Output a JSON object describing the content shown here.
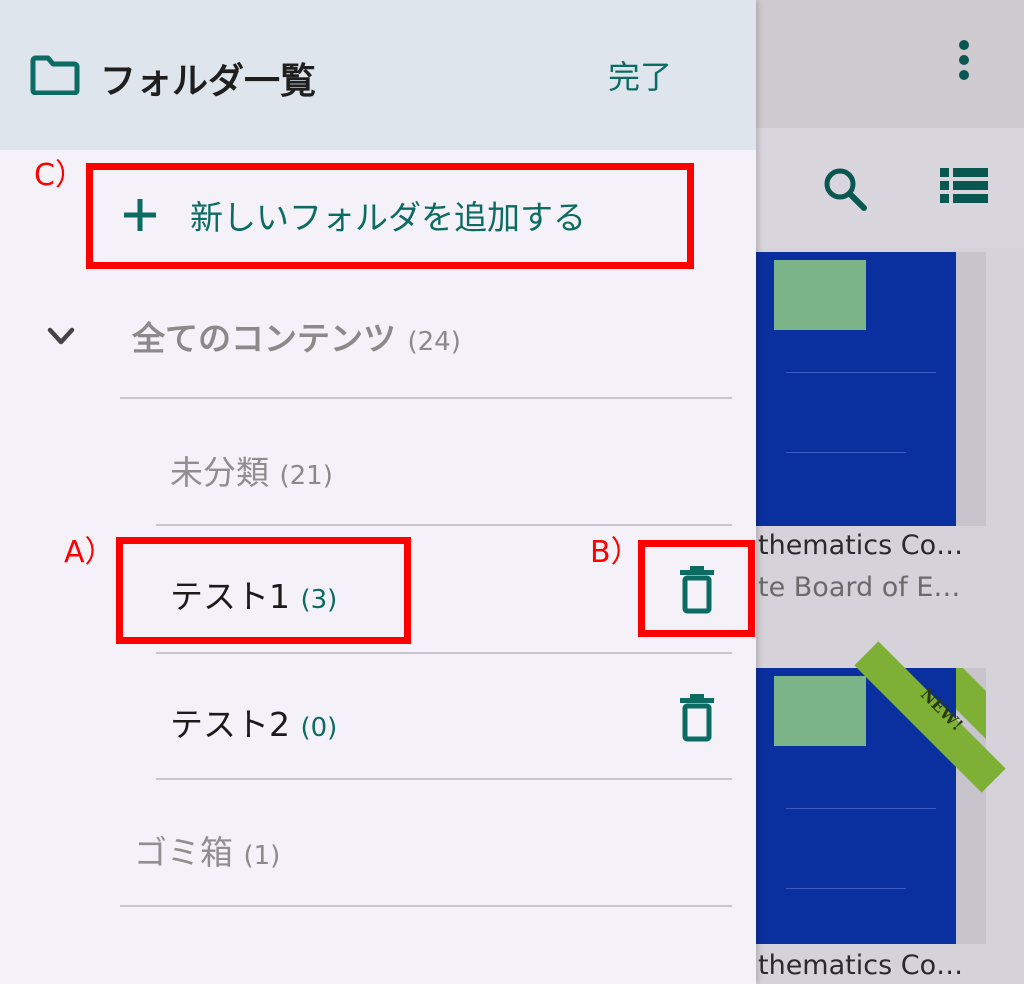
{
  "header": {
    "title": "フォルダ一覧",
    "done_label": "完了"
  },
  "add_folder": {
    "label": "新しいフォルダを追加する"
  },
  "tree": {
    "all": {
      "label": "全てのコンテンツ",
      "count": "(24)"
    },
    "uncategorized": {
      "label": "未分類",
      "count": "(21)"
    },
    "folders": [
      {
        "label": "テスト1",
        "count": "(3)"
      },
      {
        "label": "テスト2",
        "count": "(0)"
      }
    ],
    "trash": {
      "label": "ゴミ箱",
      "count": "(1)"
    }
  },
  "annotations": {
    "a": "A）",
    "b": "B）",
    "c": "C）"
  },
  "background": {
    "book1_title": "thematics Co…",
    "book1_subtitle": "te Board of E…",
    "book2_title": "thematics Co…",
    "new_ribbon": "NEW!"
  },
  "colors": {
    "accent": "#0c6b63",
    "highlight": "#ff0000",
    "header_bg": "#dfe5ec",
    "drawer_bg": "#f5f1f8"
  },
  "icons": {
    "header": "folder-icon",
    "add": "plus-icon",
    "expand": "chevron-down-icon",
    "delete": "trash-icon",
    "search": "search-icon",
    "view": "list-view-icon",
    "menu": "more-vert-icon"
  }
}
